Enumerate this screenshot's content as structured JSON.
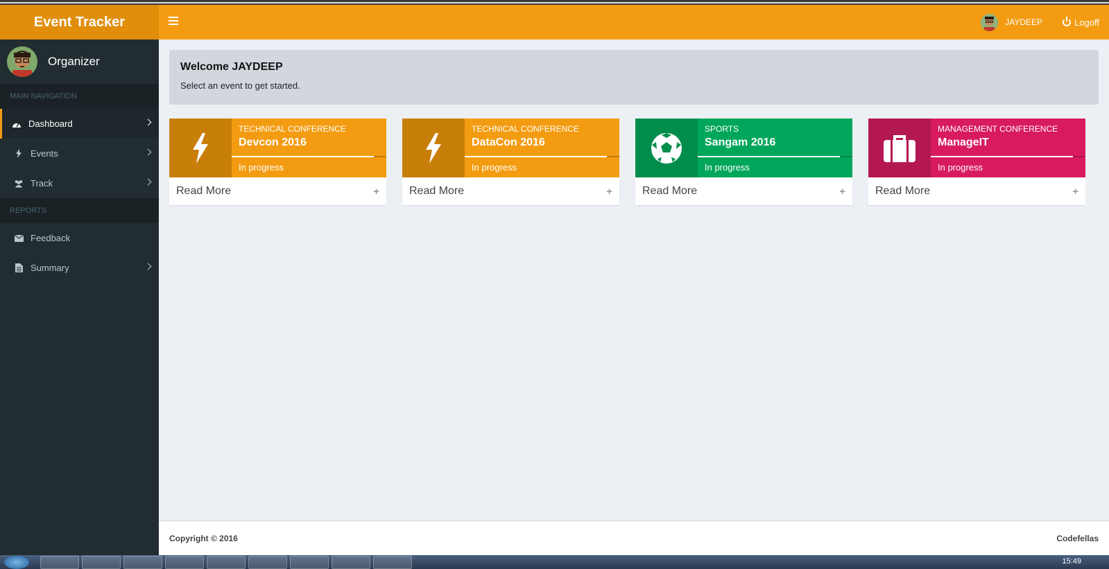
{
  "app": {
    "logo": "Event Tracker",
    "user_name": "JAYDEEP",
    "logoff_label": "Logoff"
  },
  "sidebar": {
    "user": "Organizer",
    "sections": [
      {
        "header": "MAIN NAVIGATION"
      },
      {
        "header": "REPORTS"
      }
    ],
    "items": [
      {
        "label": "Dashboard",
        "icon": "dashboard-icon",
        "active": true
      },
      {
        "label": "Events",
        "icon": "bolt-icon"
      },
      {
        "label": "Track",
        "icon": "users-icon"
      },
      {
        "label": "Feedback",
        "icon": "envelope-icon"
      },
      {
        "label": "Summary",
        "icon": "file-icon"
      }
    ]
  },
  "welcome": {
    "title": "Welcome JAYDEEP",
    "subtitle": "Select an event to get started."
  },
  "events": [
    {
      "category": "TECHNICAL CONFERENCE",
      "title": "Devcon 2016",
      "status": "In progress",
      "footer": "Read More",
      "icon": "bolt-icon",
      "color": "#f39c12",
      "progress": 0.92
    },
    {
      "category": "TECHNICAL CONFERENCE",
      "title": "DataCon 2016",
      "status": "In progress",
      "footer": "Read More",
      "icon": "bolt-icon",
      "color": "#f39c12",
      "progress": 0.92
    },
    {
      "category": "SPORTS",
      "title": "Sangam 2016",
      "status": "In progress",
      "footer": "Read More",
      "icon": "soccer-ball-icon",
      "color": "#00a65a",
      "progress": 0.92
    },
    {
      "category": "MANAGEMENT CONFERENCE",
      "title": "ManageIT",
      "status": "In progress",
      "footer": "Read More",
      "icon": "briefcase-icon",
      "color": "#d81b60",
      "progress": 0.92
    }
  ],
  "footer": {
    "copyright": "Copyright © 2016",
    "brand": "Codefellas"
  },
  "taskbar": {
    "clock": "15:49"
  }
}
